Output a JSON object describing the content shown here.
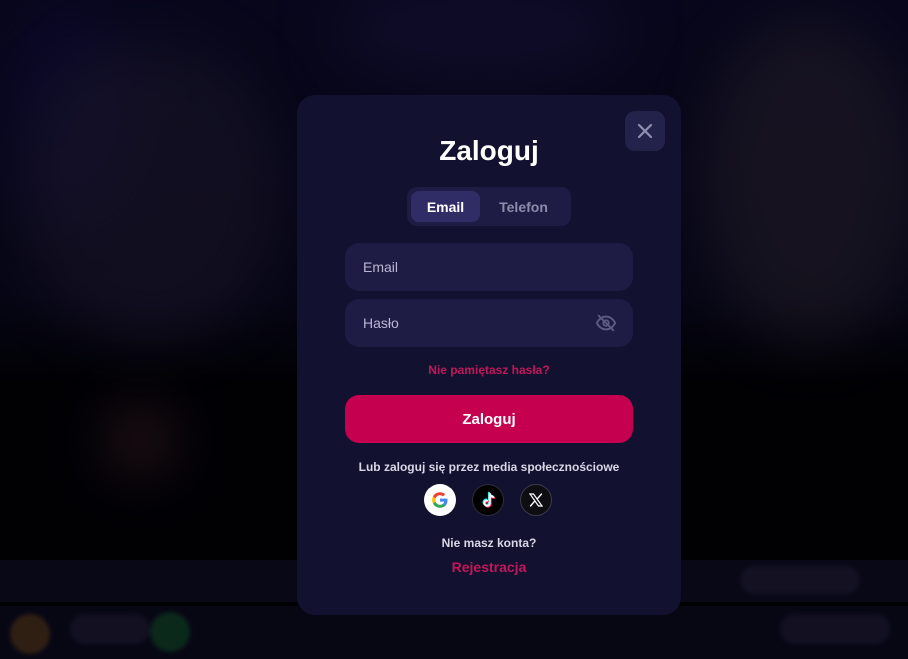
{
  "modal": {
    "title": "Zaloguj",
    "tabs": [
      {
        "label": "Email",
        "active": true
      },
      {
        "label": "Telefon",
        "active": false
      }
    ],
    "email_placeholder": "Email",
    "password_placeholder": "Hasło",
    "password_toggle_icon": "eye-off-icon",
    "forgot_password": "Nie pamiętasz hasła?",
    "submit_label": "Zaloguj",
    "social_prompt": "Lub zaloguj się przez media społecznościowe",
    "social_providers": [
      "google",
      "tiktok",
      "x"
    ],
    "no_account_text": "Nie masz konta?",
    "register_link": "Rejestracja",
    "close_icon": "close-icon"
  },
  "colors": {
    "modal_bg": "#12112f",
    "field_bg": "#1e1c44",
    "accent": "#c4004f",
    "link": "#c2185b"
  }
}
